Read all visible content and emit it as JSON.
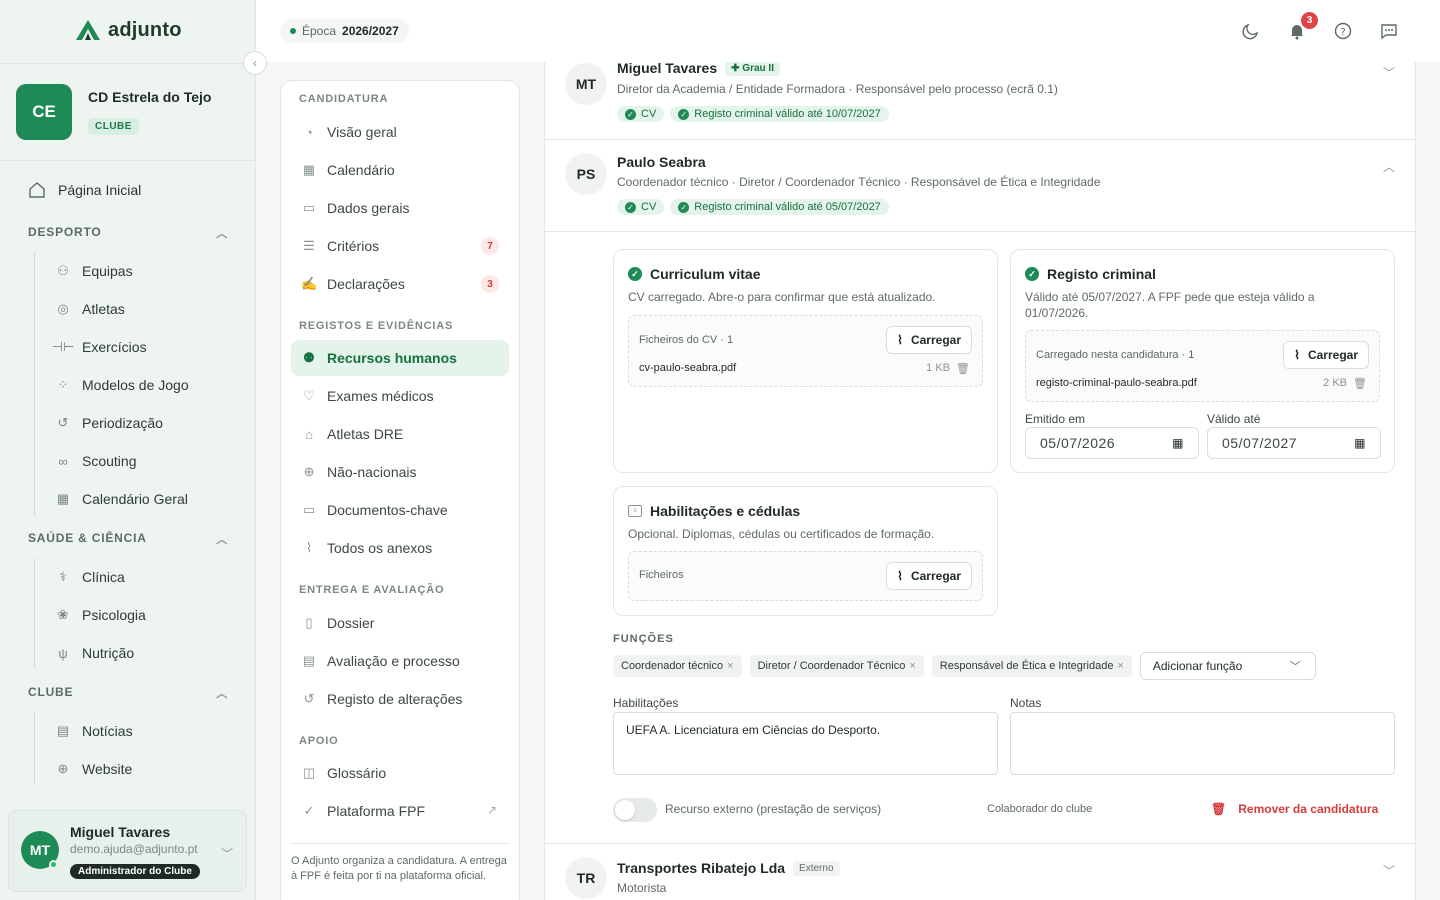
{
  "brand": {
    "name": "adjunto",
    "color": "#1e8a55"
  },
  "club": {
    "initials": "CE",
    "name": "CD Estrela do Tejo",
    "badge": "CLUBE"
  },
  "sidebar": {
    "home": "Página Inicial",
    "sections": [
      {
        "title": "DESPORTO",
        "items": [
          "Equipas",
          "Atletas",
          "Exercícios",
          "Modelos de Jogo",
          "Periodização",
          "Scouting",
          "Calendário Geral"
        ]
      },
      {
        "title": "SAÚDE & CIÊNCIA",
        "items": [
          "Clínica",
          "Psicologia",
          "Nutrição"
        ]
      },
      {
        "title": "CLUBE",
        "items": [
          "Notícias",
          "Website"
        ]
      }
    ]
  },
  "user": {
    "initials": "MT",
    "name": "Miguel Tavares",
    "email": "demo.ajuda@adjunto.pt",
    "role": "Administrador do Clube"
  },
  "topbar": {
    "season_label": "Época",
    "season_value": "2026/2027",
    "notifications": "3"
  },
  "subnav": {
    "sections": [
      {
        "title": "CANDIDATURA",
        "items": [
          {
            "label": "Visão geral"
          },
          {
            "label": "Calendário"
          },
          {
            "label": "Dados gerais"
          },
          {
            "label": "Critérios",
            "count": "7"
          },
          {
            "label": "Declarações",
            "count": "3"
          }
        ]
      },
      {
        "title": "REGISTOS E EVIDÊNCIAS",
        "items": [
          {
            "label": "Recursos humanos",
            "active": true
          },
          {
            "label": "Exames médicos"
          },
          {
            "label": "Atletas DRE"
          },
          {
            "label": "Não-nacionais"
          },
          {
            "label": "Documentos-chave"
          },
          {
            "label": "Todos os anexos"
          }
        ]
      },
      {
        "title": "ENTREGA E AVALIAÇÃO",
        "items": [
          {
            "label": "Dossier"
          },
          {
            "label": "Avaliação e processo"
          },
          {
            "label": "Registo de alterações"
          }
        ]
      },
      {
        "title": "APOIO",
        "items": [
          {
            "label": "Glossário"
          },
          {
            "label": "Plataforma FPF"
          }
        ]
      }
    ],
    "footer": "O Adjunto organiza a candidatura. A entrega à FPF é feita por ti na plataforma oficial."
  },
  "people": [
    {
      "initials": "MT",
      "name": "Miguel Tavares",
      "chip": "Grau II",
      "role": "Diretor da Academia / Entidade Formadora · Responsável pelo processo (ecrã 0.1)",
      "tags": [
        "CV",
        "Registo criminal válido até 10/07/2027"
      ]
    },
    {
      "initials": "PS",
      "name": "Paulo Seabra",
      "role": "Coordenador técnico · Diretor / Coordenador Técnico · Responsável de Ética e Integridade",
      "tags": [
        "CV",
        "Registo criminal válido até 05/07/2027"
      ]
    },
    {
      "initials": "TR",
      "name": "Transportes Ribatejo Lda",
      "chip": "Externo",
      "role": "Motorista"
    }
  ],
  "detail": {
    "cv": {
      "title": "Curriculum vitae",
      "desc": "CV carregado. Abre-o para confirmar que está atualizado.",
      "files_label": "Ficheiros do CV · 1",
      "upload": "Carregar",
      "file": "cv-paulo-seabra.pdf",
      "size": "1 KB"
    },
    "criminal": {
      "title": "Registo criminal",
      "desc": "Válido até 05/07/2027. A FPF pede que esteja válido a 01/07/2026.",
      "files_label": "Carregado nesta candidatura · 1",
      "upload": "Carregar",
      "file": "registo-criminal-paulo-seabra.pdf",
      "size": "2 KB",
      "issued_label": "Emitido em",
      "issued": "05/07/2026",
      "valid_label": "Válido até",
      "valid": "05/07/2027"
    },
    "qual": {
      "title": "Habilitações e cédulas",
      "desc": "Opcional. Diplomas, cédulas ou certificados de formação.",
      "files_label": "Ficheiros",
      "upload": "Carregar"
    },
    "functions_label": "FUNÇÕES",
    "functions": [
      "Coordenador técnico",
      "Diretor / Coordenador Técnico",
      "Responsável de Ética e Integridade"
    ],
    "add_function": "Adicionar função",
    "habilitacoes_label": "Habilitações",
    "habilitacoes": "UEFA A. Licenciatura em Ciências do Desporto.",
    "notas_label": "Notas",
    "notas": "",
    "external_label": "Recurso externo (prestação de serviços)",
    "collab": "Colaborador do clube",
    "remove": "Remover da candidatura"
  }
}
